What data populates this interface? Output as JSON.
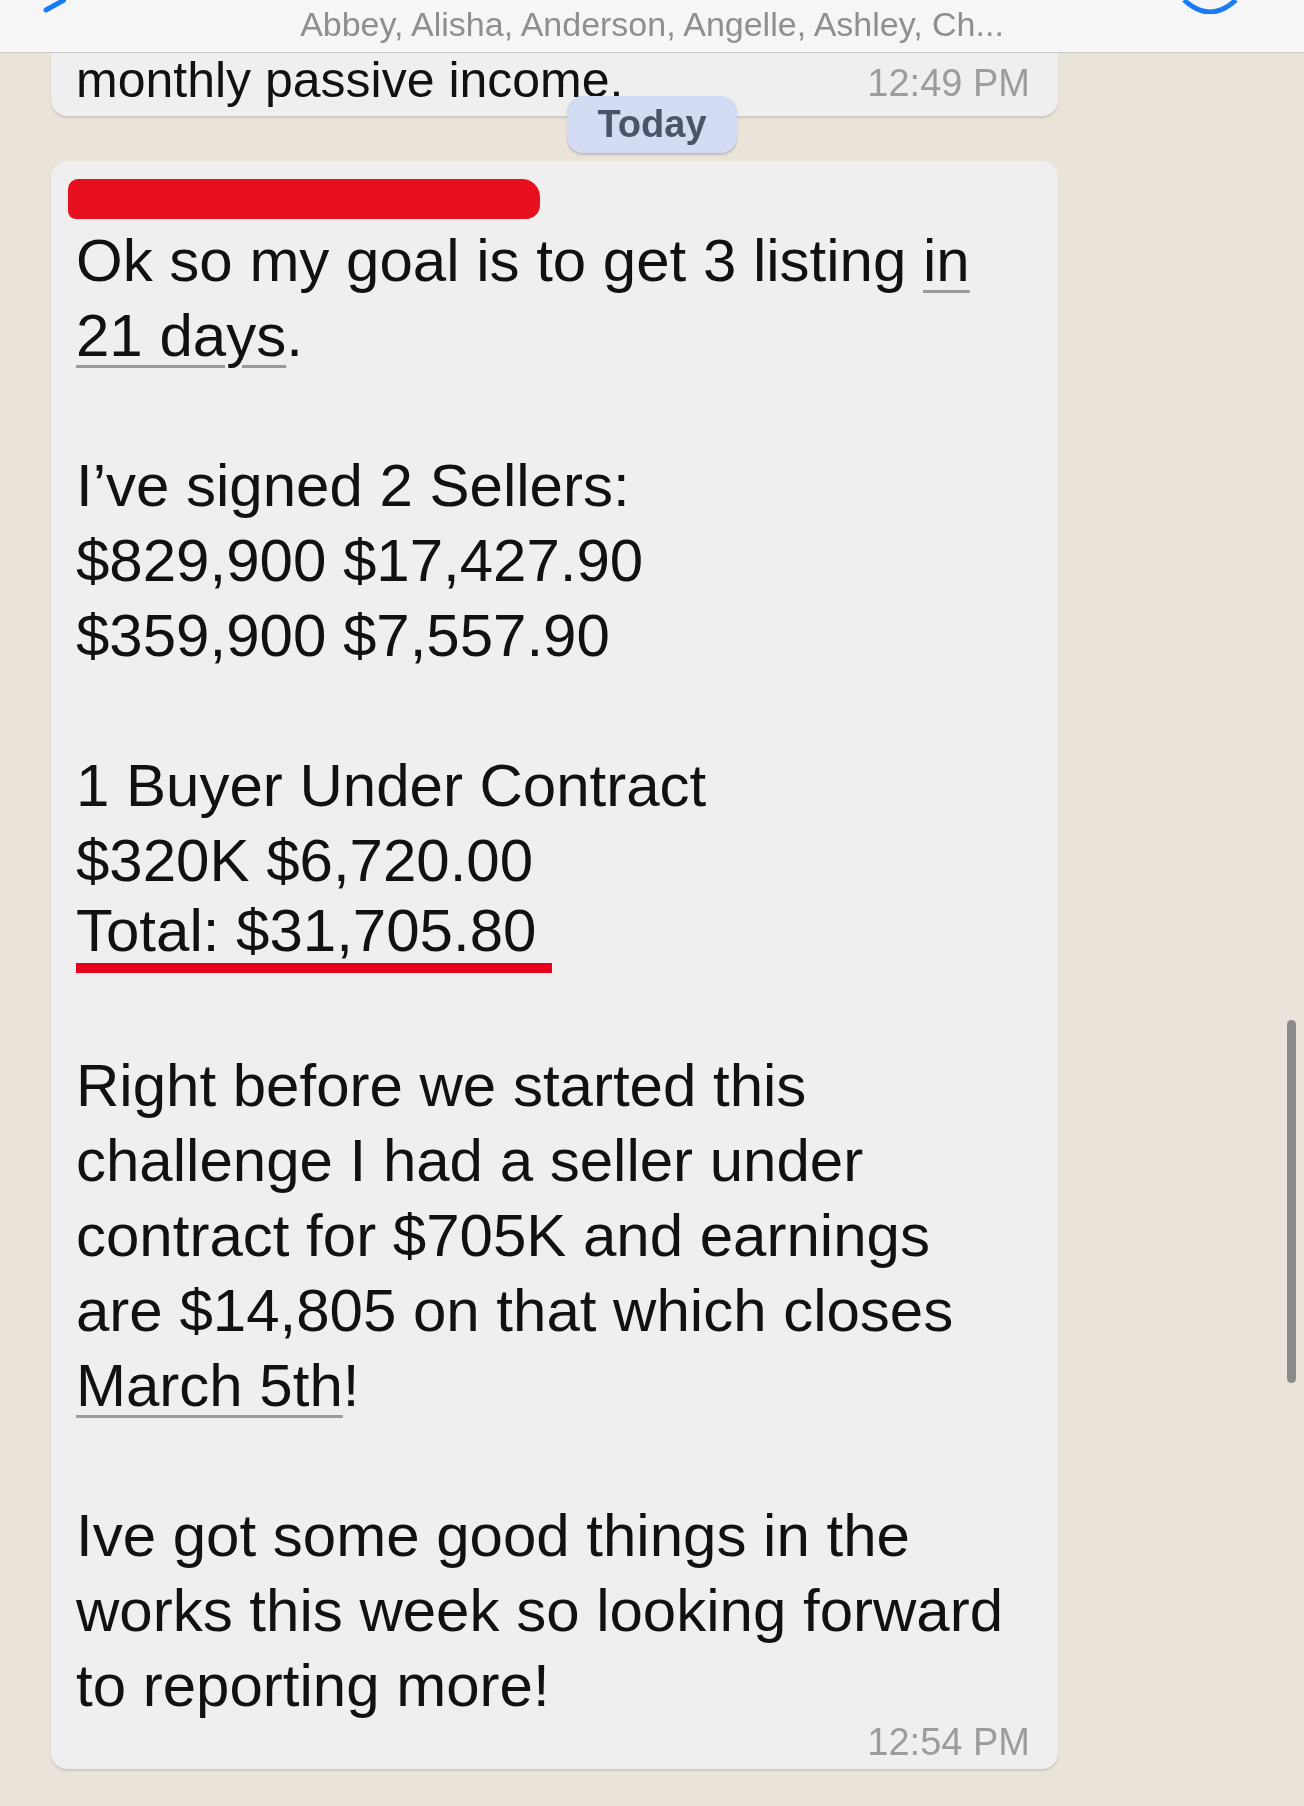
{
  "header": {
    "title": "Abbey, Alisha, Anderson, Angelle, Ashley, Ch..."
  },
  "chat": [
    {
      "kind": "message",
      "paragraphs": [
        [
          [
            {
              "text": "monthly passive income."
            }
          ]
        ]
      ],
      "time": "12:49 PM"
    },
    {
      "kind": "day",
      "label": "Today"
    },
    {
      "kind": "message",
      "redacted_sender": true,
      "paragraphs": [
        [
          [
            {
              "text": "Ok so my goal is to get 3 listing "
            },
            {
              "text": "in",
              "link": true
            }
          ],
          [
            {
              "text": "21 days",
              "link": true
            },
            {
              "text": "."
            }
          ]
        ],
        [
          [
            {
              "text": "I’ve signed 2 Sellers:"
            }
          ],
          [
            {
              "text": "$829,900 $17,427.90"
            }
          ],
          [
            {
              "text": "$359,900 $7,557.90"
            }
          ]
        ],
        [
          [
            {
              "text": "1 Buyer Under Contract"
            }
          ],
          [
            {
              "text": "$320K $6,720.00"
            }
          ],
          [
            {
              "text": "Total: $31,705.80",
              "marked": true
            }
          ]
        ],
        [
          [
            {
              "text": "Right before we started this"
            }
          ],
          [
            {
              "text": "challenge I had a seller under"
            }
          ],
          [
            {
              "text": "contract for $705K and earnings"
            }
          ],
          [
            {
              "text": "are $14,805 on that which closes"
            }
          ],
          [
            {
              "text": "March 5th",
              "link": true
            },
            {
              "text": "!"
            }
          ]
        ],
        [
          [
            {
              "text": "Ive got some good things in the"
            }
          ],
          [
            {
              "text": "works this week so looking forward"
            }
          ],
          [
            {
              "text": "to reporting more!"
            }
          ]
        ]
      ],
      "time": "12:54 PM"
    }
  ]
}
